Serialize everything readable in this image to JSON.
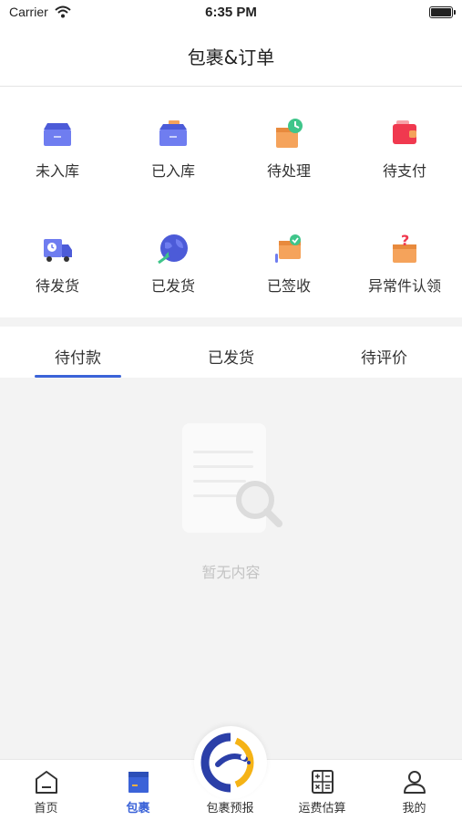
{
  "status_bar": {
    "carrier": "Carrier",
    "time": "6:35 PM"
  },
  "nav": {
    "title": "包裹&订单"
  },
  "grid": {
    "items": [
      {
        "label": "未入库",
        "icon": "box-open-icon"
      },
      {
        "label": "已入库",
        "icon": "box-stored-icon"
      },
      {
        "label": "待处理",
        "icon": "package-clock-icon"
      },
      {
        "label": "待支付",
        "icon": "wallet-icon"
      },
      {
        "label": "待发货",
        "icon": "truck-clock-icon"
      },
      {
        "label": "已发货",
        "icon": "globe-plane-icon"
      },
      {
        "label": "已签收",
        "icon": "package-check-icon"
      },
      {
        "label": "异常件认领",
        "icon": "package-question-icon"
      }
    ]
  },
  "tabs": {
    "items": [
      {
        "label": "待付款",
        "active": true
      },
      {
        "label": "已发货",
        "active": false
      },
      {
        "label": "待评价",
        "active": false
      }
    ],
    "accent": "#3b63d8"
  },
  "empty": {
    "text": "暂无内容"
  },
  "tabbar": {
    "items": [
      {
        "label": "首页",
        "icon": "home-icon"
      },
      {
        "label": "包裹",
        "icon": "package-icon",
        "active": true
      },
      {
        "label": "包裹预报",
        "icon": "logo-icon"
      },
      {
        "label": "运费估算",
        "icon": "calculator-icon"
      },
      {
        "label": "我的",
        "icon": "user-icon"
      }
    ]
  }
}
